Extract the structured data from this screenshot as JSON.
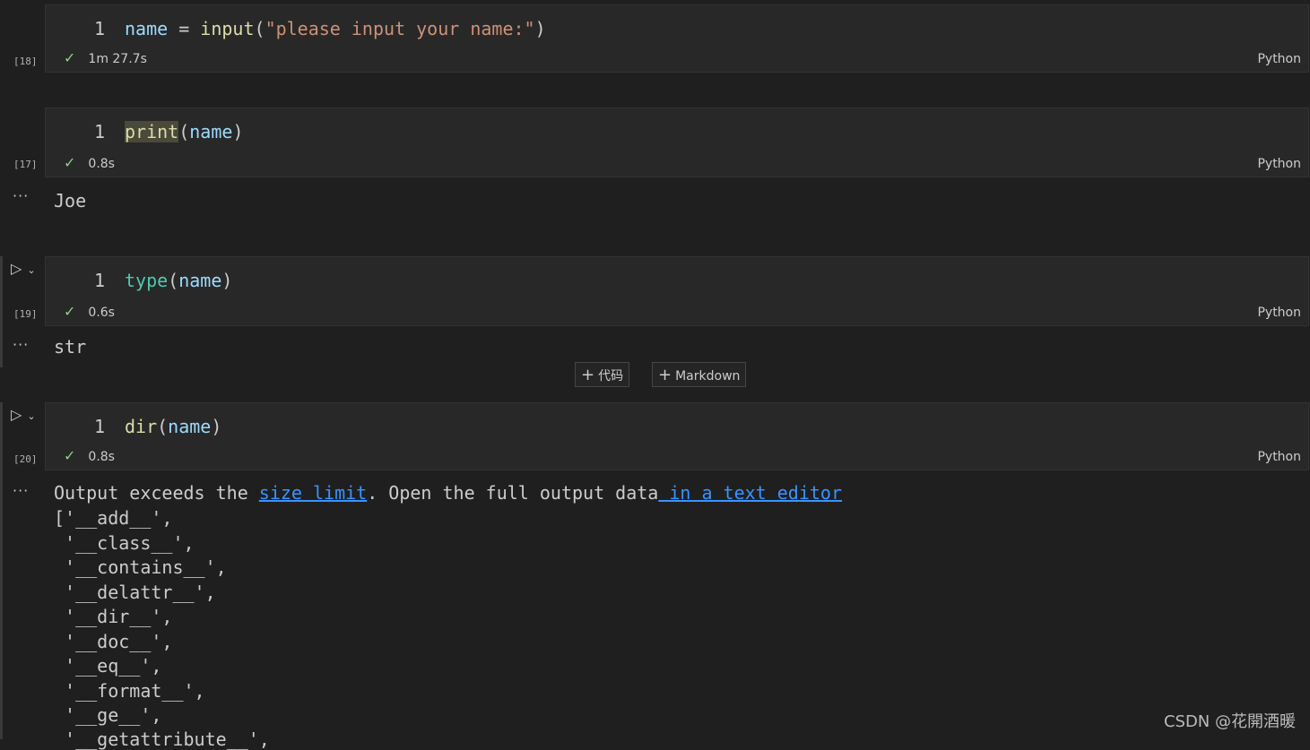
{
  "cells": [
    {
      "exec_count": "[18]",
      "line_number": "1",
      "code": {
        "var": "name",
        "op": " = ",
        "fn": "input",
        "open": "(",
        "str": "\"please input your name:\"",
        "close": ")"
      },
      "duration": "1m 27.7s",
      "language": "Python"
    },
    {
      "exec_count": "[17]",
      "line_number": "1",
      "code": {
        "fn": "print",
        "open": "(",
        "arg": "name",
        "close": ")"
      },
      "duration": "0.8s",
      "language": "Python",
      "output": "Joe"
    },
    {
      "exec_count": "[19]",
      "line_number": "1",
      "code": {
        "fn": "type",
        "open": "(",
        "arg": "name",
        "close": ")"
      },
      "duration": "0.6s",
      "language": "Python",
      "output": "str"
    },
    {
      "exec_count": "[20]",
      "line_number": "1",
      "code": {
        "fn": "dir",
        "open": "(",
        "arg": "name",
        "close": ")"
      },
      "duration": "0.8s",
      "language": "Python",
      "output": {
        "prefix": "Output exceeds the ",
        "link1": "size limit",
        "middle": ". Open the full output data",
        "link2": " in a text editor",
        "lines": [
          "['__add__',",
          " '__class__',",
          " '__contains__',",
          " '__delattr__',",
          " '__dir__',",
          " '__doc__',",
          " '__eq__',",
          " '__format__',",
          " '__ge__',",
          " '__getattribute__',"
        ]
      }
    }
  ],
  "toolbar": {
    "add_code": "代码",
    "add_markdown": "Markdown"
  },
  "dots": "···",
  "watermark": "CSDN @花開酒暖"
}
